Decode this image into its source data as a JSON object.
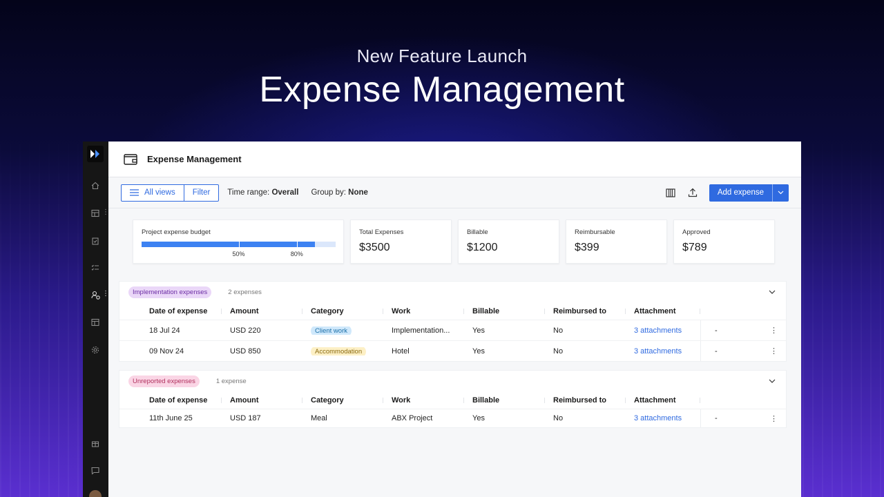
{
  "hero": {
    "subtitle": "New Feature Launch",
    "title": "Expense Management"
  },
  "app": {
    "page_title": "Expense Management",
    "toolbar": {
      "all_views": "All views",
      "filter": "Filter",
      "time_range_label": "Time range:",
      "time_range_value": "Overall",
      "group_by_label": "Group by:",
      "group_by_value": "None",
      "add_expense": "Add expense"
    },
    "budget": {
      "label": "Project expense budget",
      "fill_fraction": 0.895,
      "marks": [
        {
          "label": "50%",
          "fraction": 0.5
        },
        {
          "label": "80%",
          "fraction": 0.8
        }
      ]
    },
    "stats": [
      {
        "label": "Total Expenses",
        "value": "$3500"
      },
      {
        "label": "Billable",
        "value": "$1200"
      },
      {
        "label": "Reimbursable",
        "value": "$399"
      },
      {
        "label": "Approved",
        "value": "$789"
      }
    ],
    "columns": [
      "Date of expense",
      "Amount",
      "Category",
      "Work",
      "Billable",
      "Reimbursed to",
      "Attachment"
    ],
    "groups": [
      {
        "name": "Implementation expenses",
        "count": "2 expenses",
        "rows": [
          {
            "date": "18 Jul 24",
            "amount": "USD 220",
            "category": "Client work",
            "work": "Implementation...",
            "billable": "Yes",
            "reimbursed": "No",
            "attachment": "3 attachments",
            "dash": "-"
          },
          {
            "date": "09 Nov 24",
            "amount": "USD 850",
            "category": "Accommodation",
            "work": "Hotel",
            "billable": "Yes",
            "reimbursed": "No",
            "attachment": "3 attachments",
            "dash": "-"
          }
        ]
      },
      {
        "name": "Unreported expenses",
        "count": "1 expense",
        "rows": [
          {
            "date": "11th June 25",
            "amount": "USD 187",
            "category": "Meal",
            "work": "ABX Project",
            "billable": "Yes",
            "reimbursed": "No",
            "attachment": "3 attachments",
            "dash": "-"
          }
        ]
      }
    ]
  }
}
